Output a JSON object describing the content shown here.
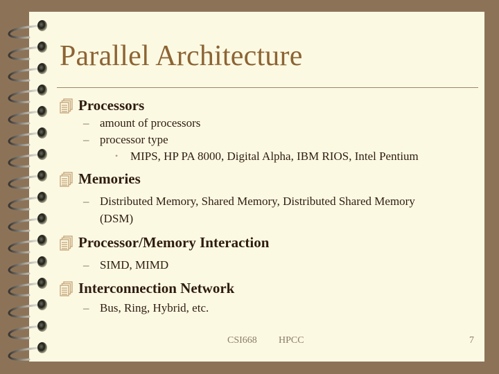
{
  "slide": {
    "title": "Parallel Architecture",
    "sections": [
      {
        "heading": "Processors",
        "items": [
          {
            "text": "amount of processors"
          },
          {
            "text": "processor type",
            "subitems": [
              "MIPS,  HP PA 8000, Digital Alpha, IBM RIOS, Intel Pentium"
            ]
          }
        ]
      },
      {
        "heading": "Memories",
        "items": [
          {
            "text": "Distributed Memory, Shared Memory, Distributed Shared Memory",
            "continuation": "(DSM)"
          }
        ]
      },
      {
        "heading": "Processor/Memory Interaction",
        "items": [
          {
            "text": "SIMD, MIMD"
          }
        ]
      },
      {
        "heading": "Interconnection Network",
        "items": [
          {
            "text": "Bus, Ring, Hybrid, etc."
          }
        ]
      }
    ],
    "footer": {
      "course": "CSI668",
      "topic": "HPCC",
      "page_number": "7"
    },
    "icons": {
      "level1": "stacked-pages-icon",
      "level2": "dash",
      "level3": "dot-bullet",
      "binding": "spiral-ring-icon"
    }
  },
  "colors": {
    "background": "#8c7358",
    "page": "#fcf9e3",
    "title": "#8c6434",
    "text": "#2e1c0e",
    "bullet_icon": "#c7a97e",
    "footer_text": "#8a7a68"
  }
}
